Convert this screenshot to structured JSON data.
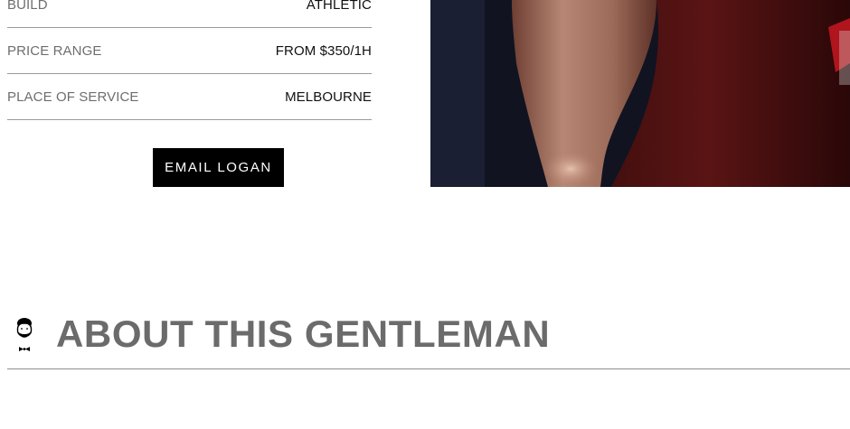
{
  "details": [
    {
      "label": "BUILD",
      "value": "ATHLETIC"
    },
    {
      "label": "PRICE RANGE",
      "value": "FROM $350/1H"
    },
    {
      "label": "PLACE OF SERVICE",
      "value": "MELBOURNE"
    }
  ],
  "contact": {
    "email_label": "EMAIL LOGAN"
  },
  "about": {
    "title": "ABOUT THIS GENTLEMAN"
  },
  "colors": {
    "button_bg": "#000000",
    "label_text": "#6e6e6e",
    "value_text": "#111111",
    "heading_text": "#6b6b6b",
    "divider": "#9a9a9a"
  },
  "icons": [
    "gentleman-bowtie-icon"
  ]
}
